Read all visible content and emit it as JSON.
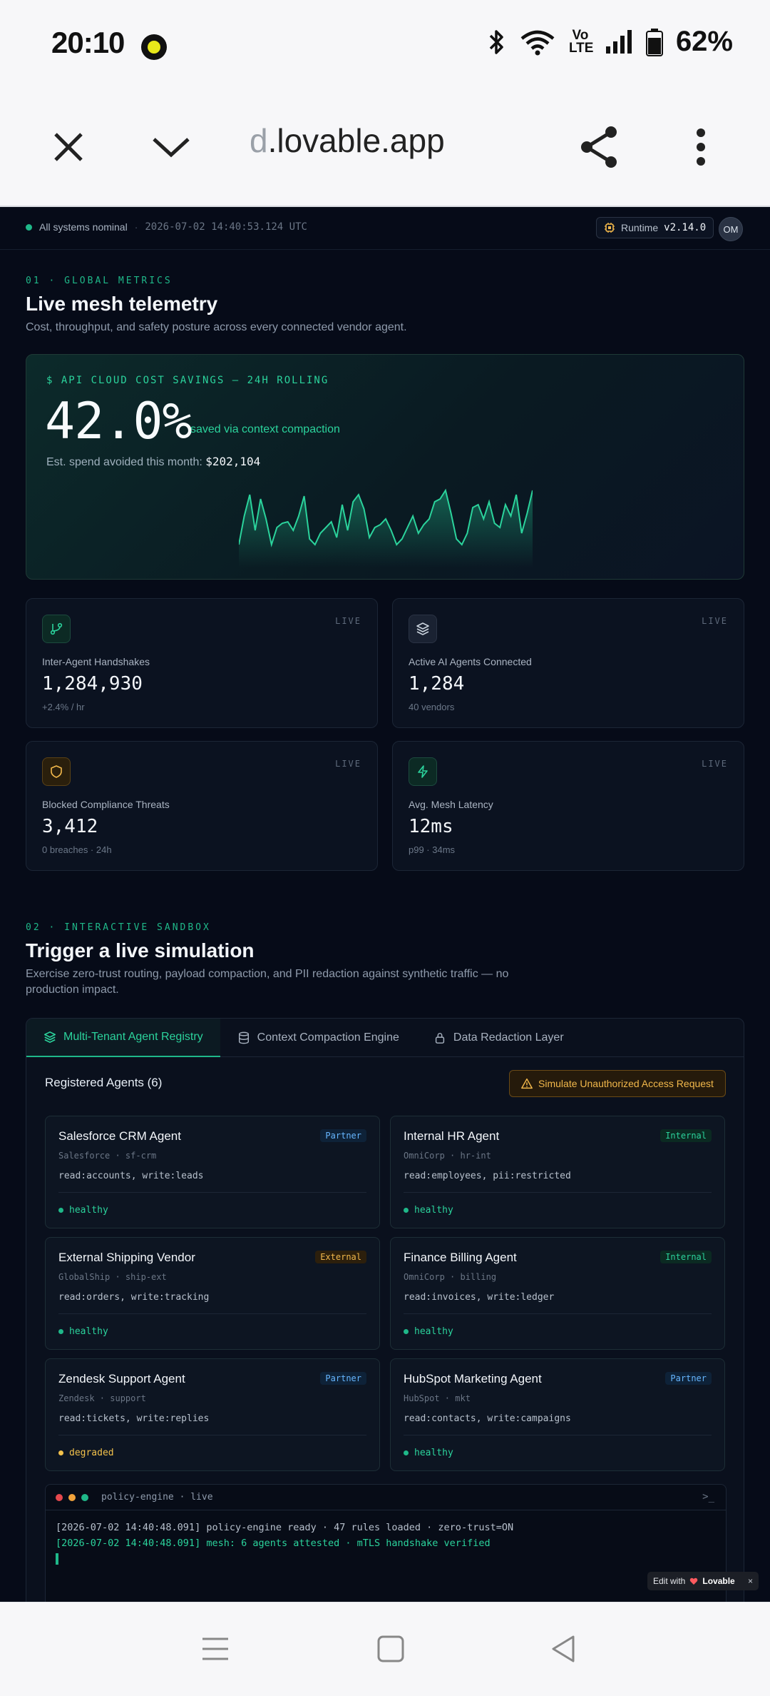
{
  "status_bar": {
    "time": "20:10",
    "volte": "Vo LTE",
    "battery": "62%"
  },
  "browser": {
    "url_faded": "d",
    "url_main": ".lovable.app"
  },
  "topline": {
    "status": "All systems nominal",
    "separator": "·",
    "timestamp": "2026-07-02 14:40:53.124 UTC",
    "runtime_label": "Runtime",
    "runtime_version": "v2.14.0",
    "avatar": "OM"
  },
  "section1": {
    "eyebrow": "01 · GLOBAL METRICS",
    "title": "Live mesh telemetry",
    "subtitle": "Cost, throughput, and safety posture across every connected vendor agent."
  },
  "hero": {
    "label": "$ API CLOUD COST SAVINGS — 24H ROLLING",
    "value": "42.0%",
    "caption": "saved via context compaction",
    "est_label": "Est. spend avoided this month: ",
    "est_value": "$202,104"
  },
  "sparkline": {
    "values": [
      10,
      30,
      45,
      20,
      42,
      28,
      10,
      22,
      25,
      26,
      20,
      30,
      44,
      14,
      10,
      18,
      22,
      26,
      15,
      38,
      20,
      40,
      45,
      35,
      15,
      22,
      24,
      28,
      20,
      10,
      14,
      22,
      30,
      18,
      24,
      28,
      40,
      42,
      48,
      32,
      14,
      10,
      18,
      36,
      38,
      28,
      40,
      25,
      22,
      38,
      30,
      45,
      18,
      32,
      48
    ]
  },
  "metrics": [
    {
      "label": "Inter-Agent Handshakes",
      "value": "1,284,930",
      "sub": "+2.4% / hr",
      "live": "LIVE",
      "icon": "git-branch-icon"
    },
    {
      "label": "Active AI Agents Connected",
      "value": "1,284",
      "sub": "40 vendors",
      "live": "LIVE",
      "icon": "layers-icon"
    },
    {
      "label": "Blocked Compliance Threats",
      "value": "3,412",
      "sub": "0 breaches · 24h",
      "live": "LIVE",
      "icon": "shield-icon"
    },
    {
      "label": "Avg. Mesh Latency",
      "value": "12ms",
      "sub": "p99 · 34ms",
      "live": "LIVE",
      "icon": "zap-icon"
    }
  ],
  "section2": {
    "eyebrow": "02 · INTERACTIVE SANDBOX",
    "title": "Trigger a live simulation",
    "subtitle_line1": "Exercise zero-trust routing, payload compaction, and PII redaction against synthetic traffic — no",
    "subtitle_line2": "production impact."
  },
  "tabs": [
    {
      "label": "Multi-Tenant Agent Registry"
    },
    {
      "label": "Context Compaction Engine"
    },
    {
      "label": "Data Redaction Layer"
    }
  ],
  "registry": {
    "title": "Registered Agents (6)",
    "simulate_button": "Simulate Unauthorized Access Request"
  },
  "agents": [
    {
      "name": "Salesforce CRM Agent",
      "badge": "Partner",
      "vendor": "Salesforce · sf-crm",
      "scope": "read:accounts, write:leads",
      "health": "healthy"
    },
    {
      "name": "Internal HR Agent",
      "badge": "Internal",
      "vendor": "OmniCorp · hr-int",
      "scope": "read:employees, pii:restricted",
      "health": "healthy"
    },
    {
      "name": "External Shipping Vendor",
      "badge": "External",
      "vendor": "GlobalShip · ship-ext",
      "scope": "read:orders, write:tracking",
      "health": "healthy"
    },
    {
      "name": "Finance Billing Agent",
      "badge": "Internal",
      "vendor": "OmniCorp · billing",
      "scope": "read:invoices, write:ledger",
      "health": "healthy"
    },
    {
      "name": "Zendesk Support Agent",
      "badge": "Partner",
      "vendor": "Zendesk · support",
      "scope": "read:tickets, write:replies",
      "health": "degraded"
    },
    {
      "name": "HubSpot Marketing Agent",
      "badge": "Partner",
      "vendor": "HubSpot · mkt",
      "scope": "read:contacts, write:campaigns",
      "health": "healthy"
    }
  ],
  "terminal": {
    "title": "policy-engine · live",
    "prompt": ">_",
    "line1": "[2026-07-02 14:40:48.091] policy-engine ready · 47 rules loaded · zero-trust=ON",
    "line2": "[2026-07-02 14:40:48.091] mesh: 6 agents attested · mTLS handshake verified"
  },
  "edit_with": {
    "label": "Edit with",
    "brand": "Lovable",
    "close": "×"
  },
  "colors": {
    "accent": "#1fb889",
    "warning": "#f2b84b",
    "background": "#060b18"
  }
}
